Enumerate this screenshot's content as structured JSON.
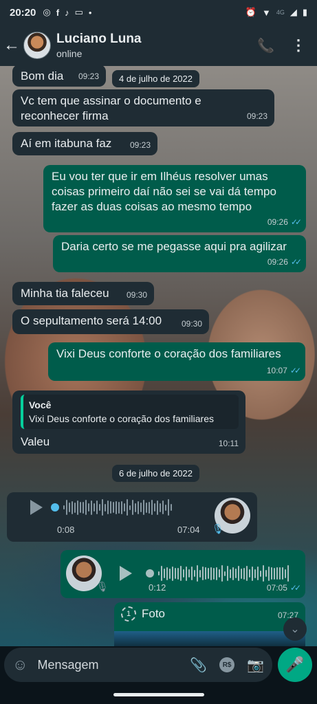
{
  "status_bar": {
    "time": "20:20",
    "network": "4G",
    "icons": [
      "whatsapp-icon",
      "facebook-icon",
      "tiktok-icon",
      "message-icon",
      "dot-icon",
      "alarm-icon",
      "wifi-icon",
      "signal-icon",
      "battery-icon"
    ]
  },
  "header": {
    "contact_name": "Luciano Luna",
    "presence": "online",
    "icons": [
      "back-arrow-icon",
      "add-call-icon",
      "more-vert-icon"
    ]
  },
  "dates": {
    "first": "4 de julho de 2022",
    "second": "6 de julho de 2022"
  },
  "messages": [
    {
      "text": "Bom dia",
      "time": "09:23"
    },
    {
      "text": "Vc tem que  assinar o documento e reconhecer firma",
      "time": "09:23"
    },
    {
      "text": "Aí em itabuna faz",
      "time": "09:23"
    },
    {
      "text": "Eu vou ter que ir em Ilhéus resolver umas coisas primeiro daí não sei se vai dá tempo fazer as duas coisas ao mesmo tempo",
      "time": "09:26"
    },
    {
      "text": "Daria certo se me pegasse aqui pra agilizar",
      "time": "09:26"
    },
    {
      "text": "Minha tia faleceu",
      "time": "09:30"
    },
    {
      "text": "O sepultamento será 14:00",
      "time": "09:30"
    },
    {
      "text": "Vixi Deus conforte o coração dos familiares",
      "time": "10:07"
    },
    {
      "quote_author": "Você",
      "quote_text": "Vixi Deus conforte o coração dos familiares",
      "text": "Valeu",
      "time": "10:11"
    }
  ],
  "voice_messages": [
    {
      "duration_elapsed": "0:08",
      "time": "07:04"
    },
    {
      "duration_elapsed": "0:12",
      "time": "07:05"
    }
  ],
  "photo_message": {
    "label": "Foto",
    "time": "07:27"
  },
  "composer": {
    "placeholder": "Mensagem",
    "payment_label": "R$",
    "icons": [
      "emoji-icon",
      "attach-icon",
      "payment-icon",
      "camera-icon",
      "mic-icon"
    ]
  },
  "colors": {
    "header_bg": "#1f2c34",
    "incoming_bubble": "#1f2c34",
    "outgoing_bubble": "#005c4b",
    "accent": "#00a884",
    "read_tick": "#53bdeb"
  }
}
